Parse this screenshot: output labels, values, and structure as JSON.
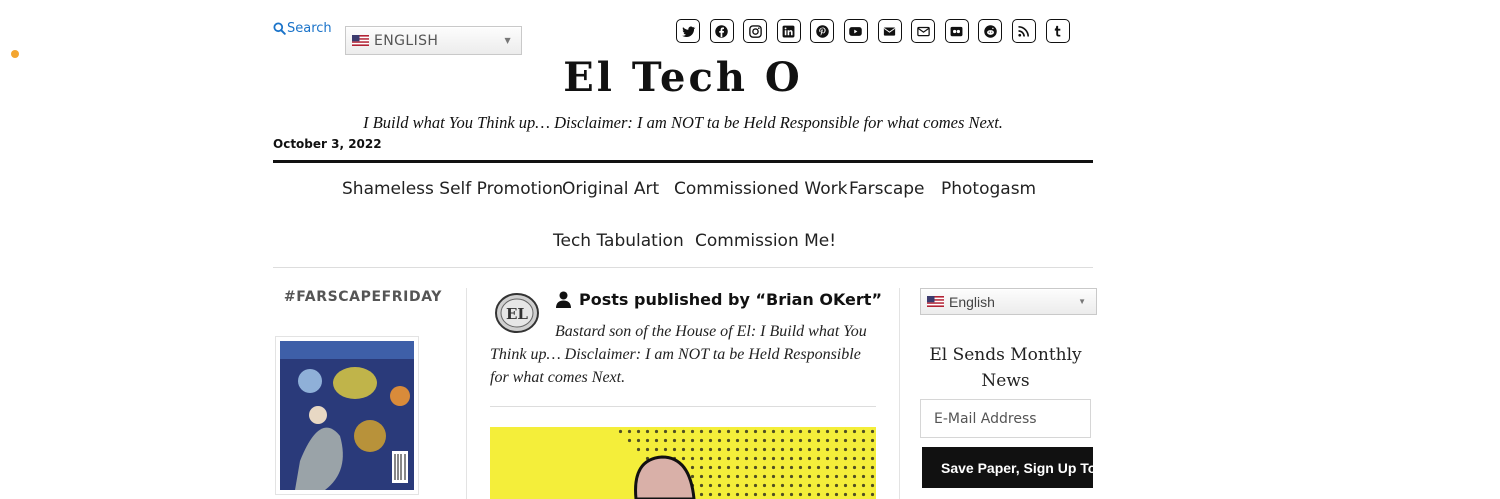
{
  "header": {
    "search_label": "Search",
    "language": "ENGLISH",
    "site_title": "El Tech O",
    "tagline": "I Build what You Think up… Disclaimer: I am NOT ta be Held Responsible for what comes Next.",
    "date": "October 3, 2022",
    "social_icons": [
      "twitter-icon",
      "facebook-icon",
      "instagram-icon",
      "linkedin-icon",
      "pinterest-icon",
      "youtube-icon",
      "email-solid-icon",
      "email-outline-icon",
      "flickr-icon",
      "reddit-icon",
      "rss-icon",
      "tumblr-icon"
    ]
  },
  "nav": {
    "items": [
      "Shameless Self Promotion",
      "Original Art",
      "Commissioned Work",
      "Farscape",
      "Photogasm",
      "Tech Tabulation",
      "Commission Me!"
    ]
  },
  "left_sidebar": {
    "title": "#FARSCAPEFRIDAY"
  },
  "main": {
    "heading": "Posts published by “Brian OKert”",
    "bio": "Bastard son of the House of El: I Build what You Think up… Disclaimer: I am NOT ta be Held Responsible for what comes Next.",
    "avatar_text": "EL"
  },
  "right_sidebar": {
    "language": "English",
    "newsletter_title": "El Sends Monthly News",
    "email_placeholder": "E-Mail Address",
    "signup_label": "Save Paper, Sign Up Today"
  },
  "colors": {
    "link": "#1a73c9",
    "accent_dot": "#f3a530",
    "signup_bg": "#111111",
    "post_image_bg": "#f4ee3a"
  }
}
